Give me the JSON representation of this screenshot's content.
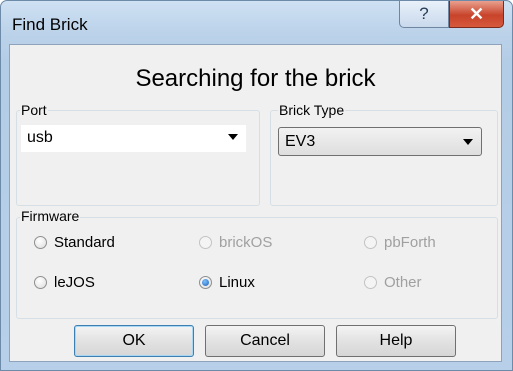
{
  "window": {
    "title": "Find Brick",
    "help_glyph": "?",
    "close_glyph": "✕"
  },
  "heading": "Searching for the brick",
  "port": {
    "label": "Port",
    "value": "usb"
  },
  "brick_type": {
    "label": "Brick Type",
    "value": "EV3"
  },
  "firmware": {
    "label": "Firmware",
    "options": [
      {
        "label": "Standard",
        "checked": false,
        "enabled": true
      },
      {
        "label": "brickOS",
        "checked": false,
        "enabled": false
      },
      {
        "label": "pbForth",
        "checked": false,
        "enabled": false
      },
      {
        "label": "leJOS",
        "checked": false,
        "enabled": true
      },
      {
        "label": "Linux",
        "checked": true,
        "enabled": true
      },
      {
        "label": "Other",
        "checked": false,
        "enabled": false
      }
    ]
  },
  "buttons": {
    "ok": "OK",
    "cancel": "Cancel",
    "help": "Help"
  }
}
